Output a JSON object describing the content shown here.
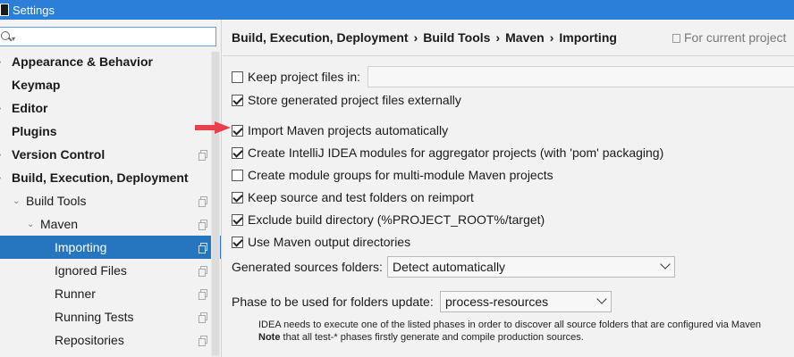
{
  "window": {
    "title": "Settings"
  },
  "search": {
    "value": "",
    "placeholder": ""
  },
  "tree": [
    {
      "label": "Appearance & Behavior",
      "bold": true,
      "arrow": true,
      "indent": 0,
      "copy": false,
      "selected": false
    },
    {
      "label": "Keymap",
      "bold": true,
      "arrow": false,
      "indent": 0,
      "copy": false,
      "selected": false
    },
    {
      "label": "Editor",
      "bold": true,
      "arrow": true,
      "indent": 0,
      "copy": false,
      "selected": false
    },
    {
      "label": "Plugins",
      "bold": true,
      "arrow": false,
      "indent": 0,
      "copy": false,
      "selected": false
    },
    {
      "label": "Version Control",
      "bold": true,
      "arrow": true,
      "indent": 0,
      "copy": true,
      "selected": false
    },
    {
      "label": "Build, Execution, Deployment",
      "bold": true,
      "arrow": true,
      "indent": 0,
      "copy": false,
      "selected": false
    },
    {
      "label": "Build Tools",
      "bold": false,
      "arrow": true,
      "indent": 1,
      "copy": true,
      "selected": false
    },
    {
      "label": "Maven",
      "bold": false,
      "arrow": true,
      "indent": 2,
      "copy": true,
      "selected": false
    },
    {
      "label": "Importing",
      "bold": false,
      "arrow": false,
      "indent": 3,
      "copy": true,
      "selected": true
    },
    {
      "label": "Ignored Files",
      "bold": false,
      "arrow": false,
      "indent": 3,
      "copy": true,
      "selected": false
    },
    {
      "label": "Runner",
      "bold": false,
      "arrow": false,
      "indent": 3,
      "copy": true,
      "selected": false
    },
    {
      "label": "Running Tests",
      "bold": false,
      "arrow": false,
      "indent": 3,
      "copy": true,
      "selected": false
    },
    {
      "label": "Repositories",
      "bold": false,
      "arrow": false,
      "indent": 3,
      "copy": true,
      "selected": false
    }
  ],
  "breadcrumb": [
    "Build, Execution, Deployment",
    "Build Tools",
    "Maven",
    "Importing"
  ],
  "breadcrumb_sep": "›",
  "for_current_project": "For current project",
  "options": [
    {
      "label": "Keep project files in:",
      "checked": false
    },
    {
      "label": "Store generated project files externally",
      "checked": true
    },
    {
      "label": "Import Maven projects automatically",
      "checked": true
    },
    {
      "label": "Create IntelliJ IDEA modules for aggregator projects (with 'pom' packaging)",
      "checked": true
    },
    {
      "label": "Create module groups for multi-module Maven projects",
      "checked": false
    },
    {
      "label": "Keep source and test folders on reimport",
      "checked": true
    },
    {
      "label": "Exclude build directory (%PROJECT_ROOT%/target)",
      "checked": true
    },
    {
      "label": "Use Maven output directories",
      "checked": true
    }
  ],
  "generated_sources": {
    "label": "Generated sources folders:",
    "value": "Detect automatically"
  },
  "phase": {
    "label": "Phase to be used for folders update:",
    "value": "process-resources"
  },
  "note": {
    "line1": "IDEA needs to execute one of the listed phases in order to discover all source folders that are configured via Maven",
    "line2_bold": "Note",
    "line2_rest": " that all test-* phases firstly generate and compile production sources."
  },
  "colors": {
    "titlebar": "#2b7fd6",
    "selection": "#2675bf",
    "arrow": "#e8414b"
  }
}
